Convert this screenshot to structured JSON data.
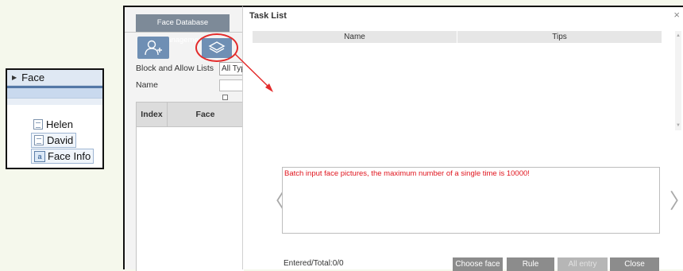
{
  "tree": {
    "root_label": "Face",
    "items": [
      {
        "label": "Helen"
      },
      {
        "label": "David"
      },
      {
        "label": "Face Info"
      }
    ]
  },
  "face_db": {
    "tab_label": "Face Database Management",
    "block_allow_label": "Block and Allow Lists",
    "type_select_value": "All Typ",
    "name_label": "Name",
    "columns": [
      "Index",
      "Face"
    ]
  },
  "task_list": {
    "title": "Task List",
    "close_glyph": "×",
    "columns": [
      "Name",
      "Tips"
    ],
    "message": "Batch input face pictures, the maximum number of a single time is 10000!",
    "status": "Entered/Total:0/0",
    "buttons": {
      "choose_face": "Choose face",
      "rule": "Rule",
      "all_entry": "All entry",
      "close": "Close"
    },
    "prev_glyph": "〈",
    "next_glyph": "〉"
  },
  "colors": {
    "accent_button": "#6f8fb4",
    "highlight_ring": "#e32b2b",
    "message_text": "#e0141d",
    "action_button": "#8c8c8c"
  }
}
